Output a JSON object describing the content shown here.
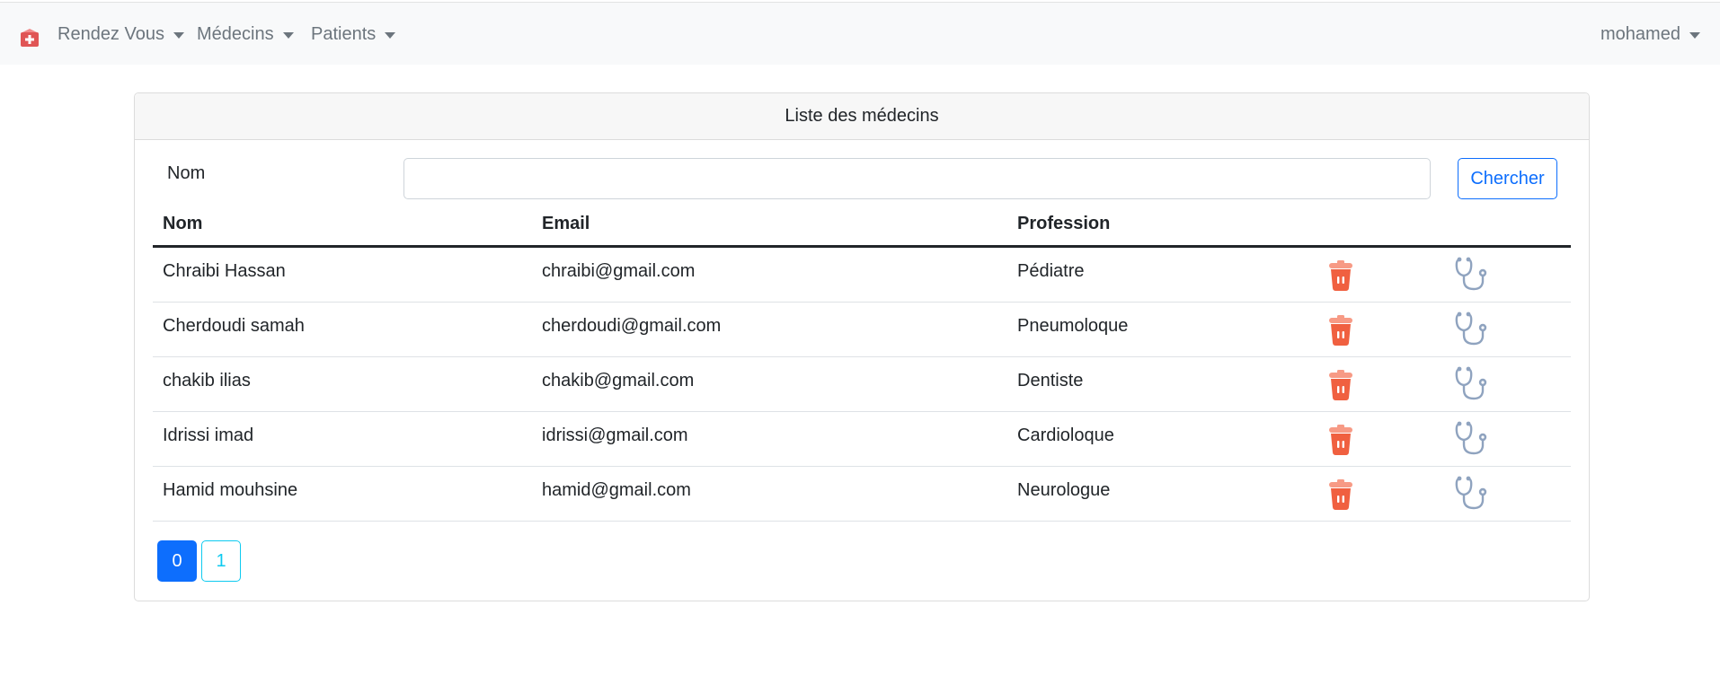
{
  "navbar": {
    "brand_icon": "hospital-icon",
    "items": [
      {
        "label": "Rendez Vous"
      },
      {
        "label": "Médecins"
      },
      {
        "label": "Patients"
      }
    ],
    "user": "mohamed"
  },
  "card": {
    "title": "Liste des médecins",
    "search": {
      "label": "Nom",
      "value": "",
      "button_label": "Chercher"
    },
    "table": {
      "headers": {
        "name": "Nom",
        "email": "Email",
        "profession": "Profession"
      },
      "rows": [
        {
          "name": "Chraibi Hassan",
          "email": "chraibi@gmail.com",
          "profession": "Pédiatre"
        },
        {
          "name": "Cherdoudi samah",
          "email": "cherdoudi@gmail.com",
          "profession": "Pneumoloque"
        },
        {
          "name": "chakib ilias",
          "email": "chakib@gmail.com",
          "profession": "Dentiste"
        },
        {
          "name": "Idrissi imad",
          "email": "idrissi@gmail.com",
          "profession": "Cardioloque"
        },
        {
          "name": "Hamid mouhsine",
          "email": "hamid@gmail.com",
          "profession": "Neurologue"
        }
      ],
      "row_icons": [
        "trash-icon",
        "stethoscope-icon"
      ]
    },
    "pagination": {
      "pages": [
        "0",
        "1"
      ],
      "active": "0"
    }
  },
  "colors": {
    "primary": "#0d6efd",
    "info": "#0dcaf0",
    "delete": "#f06040",
    "stethoscope": "#8fa3bf"
  }
}
